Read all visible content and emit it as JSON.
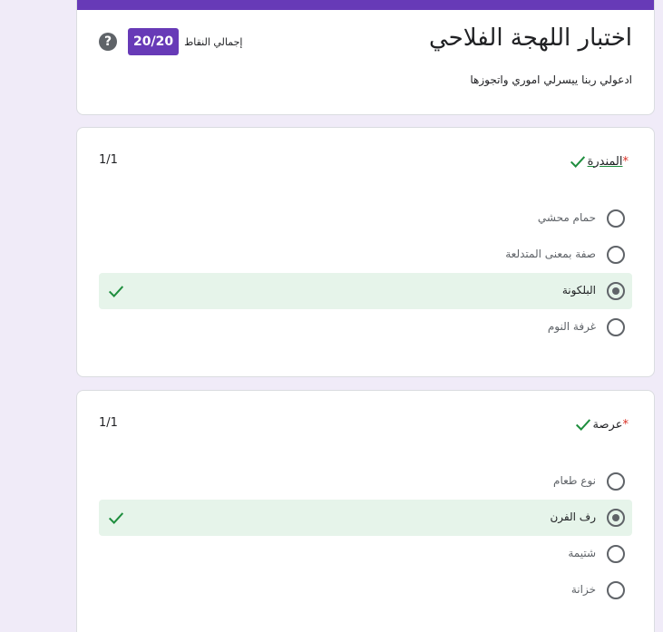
{
  "form": {
    "title": "اختبار اللهجة الفلاحي",
    "description": "ادعولي ربنا ييسرلي اموري واتجوزها",
    "score_label": "إجمالي النقاط",
    "score": "20/20",
    "help_symbol": "?"
  },
  "questions": [
    {
      "title": "المندرة",
      "required_mark": "*",
      "points": "1/1",
      "options": [
        {
          "label": "حمام محشي"
        },
        {
          "label": "صفة بمعنى المتدلعة"
        },
        {
          "label": "البلكونة",
          "selected": true,
          "correct": true
        },
        {
          "label": "غرفة النوم"
        }
      ]
    },
    {
      "title": "عرصة",
      "required_mark": "*",
      "points": "1/1",
      "options": [
        {
          "label": "نوع طعام"
        },
        {
          "label": "رف الفرن",
          "selected": true,
          "correct": true
        },
        {
          "label": "شتيمة"
        },
        {
          "label": "خزانة"
        }
      ]
    }
  ],
  "colors": {
    "accent": "#673ab7",
    "correct": "#1e8e3e",
    "correct_bg": "#e6f4ea",
    "required": "#d93025",
    "background": "#f0ebf8"
  },
  "icons": {
    "help": "help-circle-icon",
    "correct": "check-icon",
    "radio": "radio-icon"
  }
}
